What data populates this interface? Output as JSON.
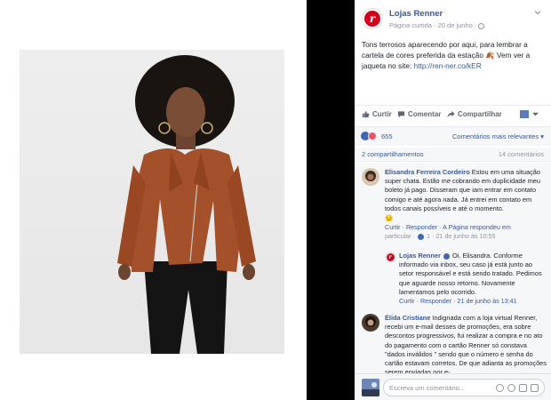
{
  "post": {
    "page_name": "Lojas Renner",
    "meta": "Página curtida · 20 de junho · ",
    "text_main": "Tons terrosos aparecendo por aqui, para lembrar a cartela de cores preferida da estação 🍂 Vem ver a jaqueta no site: ",
    "link": "http://ren-ner.co/kER"
  },
  "actions": {
    "like": "Curtir",
    "comment": "Comentar",
    "share": "Compartilhar"
  },
  "reactions": {
    "count": "655",
    "sort": "Comentários mais relevantes"
  },
  "shares": {
    "shares_label": "2 compartilhamentos",
    "comments_label": "14 comentários"
  },
  "comments": [
    {
      "author": "Elisandra Ferreira Cordeiro",
      "text": " Estou em uma situação super chata. Estão me cobrando em duplicidade meu boleto já pago. Disseram que iam entrar em contato comigo e até agora nada. Já entrei em contato em todos canais possíveis e até o momento.",
      "emoji": "😒",
      "actions_line1": "Curtir · Responder · A Página respondeu em",
      "actions_line2": "particular · ",
      "likes": "1",
      "time": " · 21 de junho às 10:55"
    },
    {
      "author": "Lojas Renner",
      "text": " Oi, Elisandra. Conforme informado via inbox, seu caso já está junto ao setor responsável e está sendo tratado. Pedimos que aguarde nosso retorno. Novamente lamentamos pelo ocorrido.",
      "actions": "Curtir · Responder · 21 de junho às 13:41"
    },
    {
      "author": "Élida Cristiane",
      "text": " Indignada com a loja virtual Renner, recebi um e-mail desses de promoções, era sobre descontos progressivos, fui realizar a compra e no ato do pagamento com o cartão Renner só constava \"dados inválidos \" sendo que o número e senha do cartão estavam corretos. De que adianta as promoções serem enviadas por e-"
    }
  ],
  "composer": {
    "placeholder": "Escreva um comentário..."
  },
  "colors": {
    "brand": "#d6001c",
    "link": "#365899",
    "like": "#4267b2",
    "love": "#f25268"
  }
}
